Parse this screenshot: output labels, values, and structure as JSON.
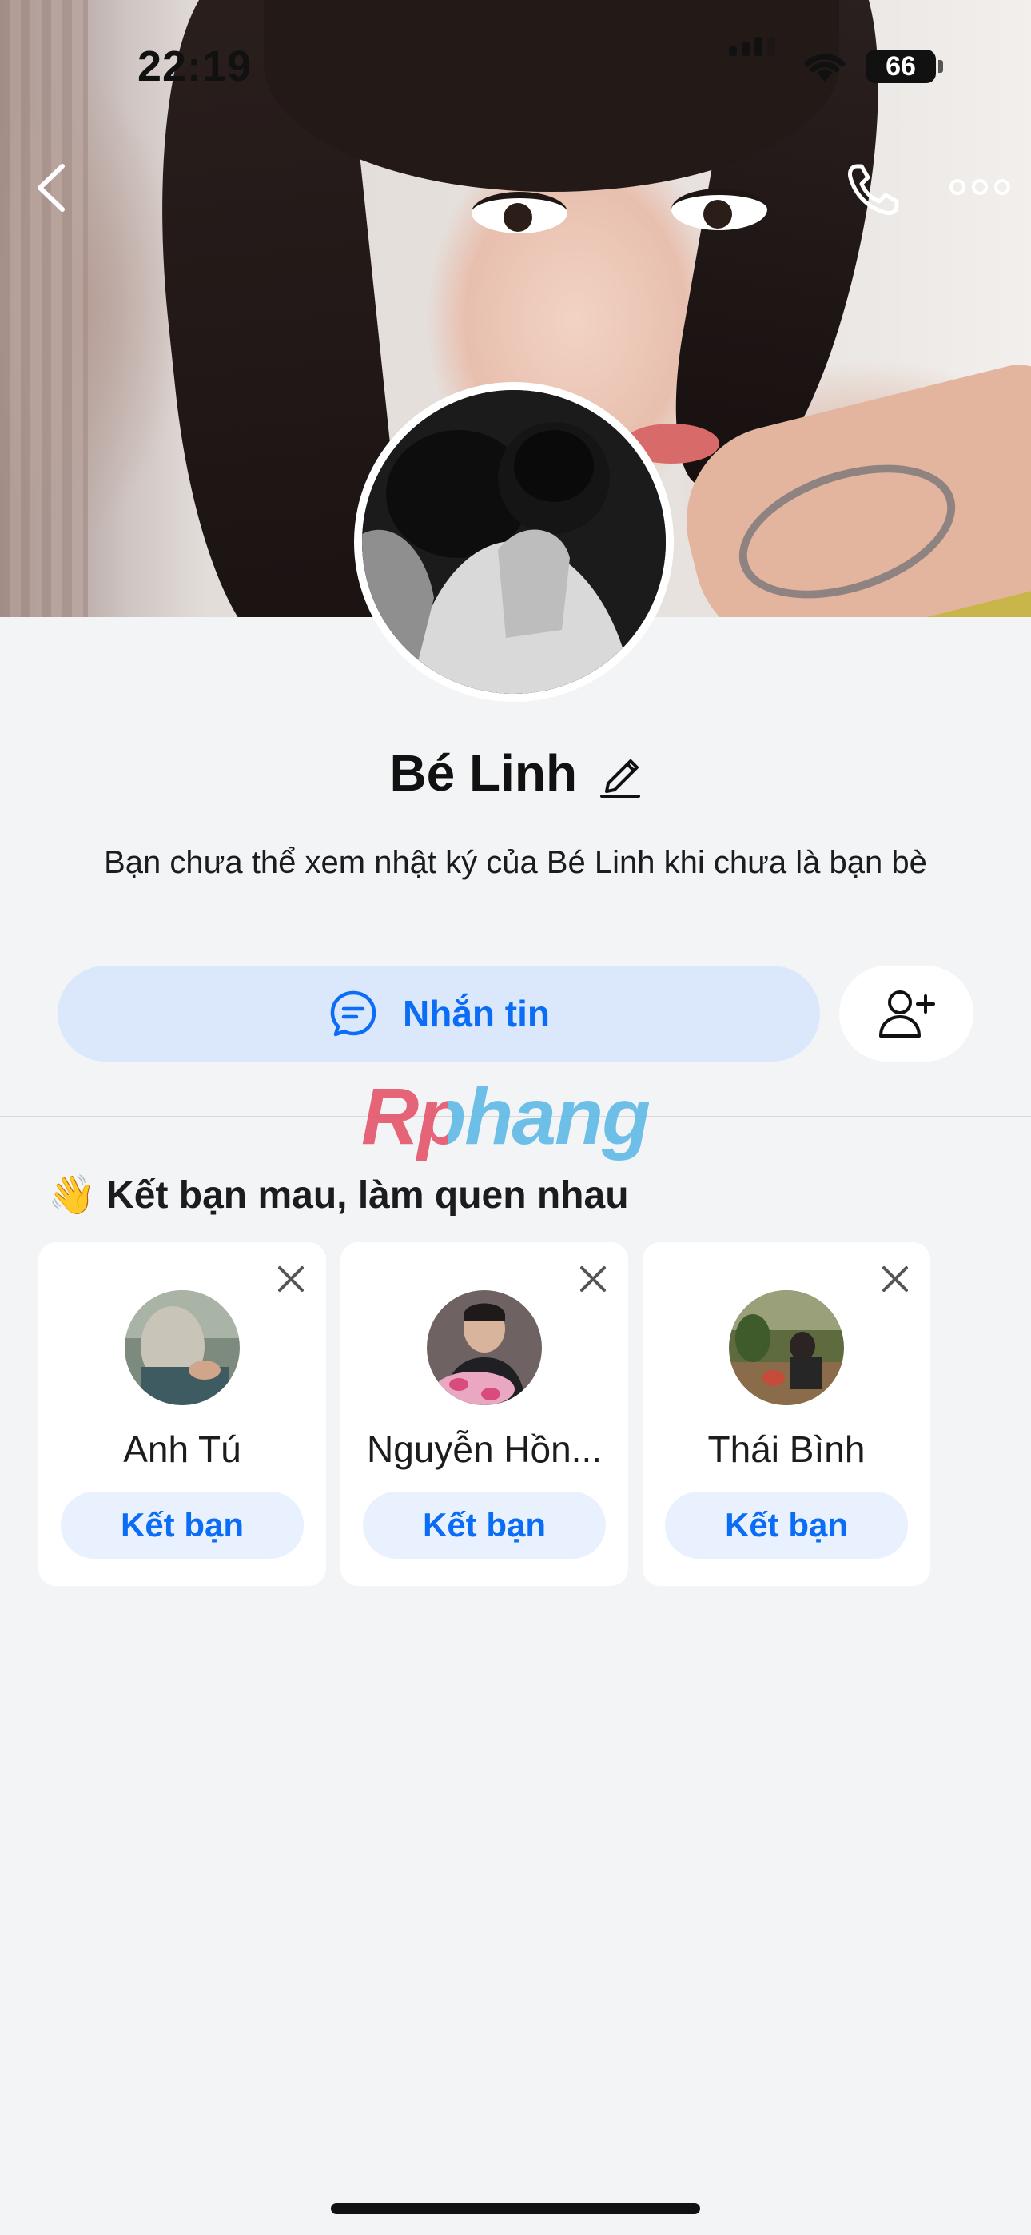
{
  "status_bar": {
    "time": "22:19",
    "battery": "66"
  },
  "profile": {
    "name": "Bé Linh",
    "description": "Bạn chưa thể xem nhật ký của Bé Linh khi chưa là bạn bè",
    "message_button": "Nhắn tin"
  },
  "watermark": "Rphang",
  "suggestions": {
    "title": "👋 Kết bạn mau, làm quen nhau",
    "cards": [
      {
        "name": "Anh Tú",
        "button": "Kết bạn"
      },
      {
        "name": "Nguyễn Hồn...",
        "button": "Kết bạn"
      },
      {
        "name": "Thái Bình",
        "button": "Kết bạn"
      }
    ]
  },
  "colors": {
    "accent": "#0b6df6",
    "accent_light": "#dbe8fc",
    "background": "#f3f4f6"
  }
}
